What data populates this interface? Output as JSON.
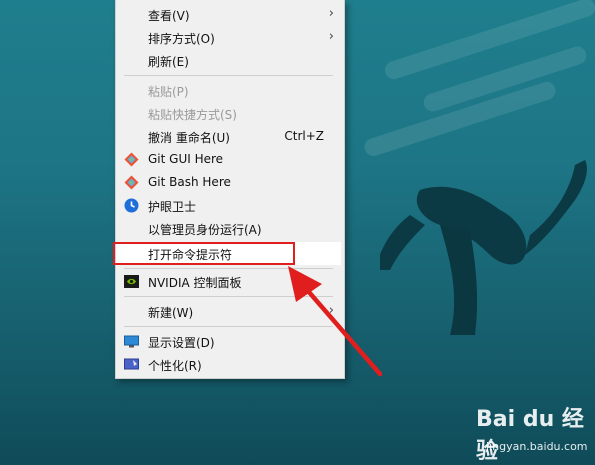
{
  "context_menu": {
    "items": [
      {
        "label": "查看(V)",
        "has_submenu": true
      },
      {
        "label": "排序方式(O)",
        "has_submenu": true
      },
      {
        "label": "刷新(E)"
      },
      {
        "label": "粘贴(P)",
        "disabled": true
      },
      {
        "label": "粘贴快捷方式(S)",
        "disabled": true
      },
      {
        "label": "撤消 重命名(U)",
        "shortcut": "Ctrl+Z"
      },
      {
        "label": "Git GUI Here",
        "icon": "git-icon"
      },
      {
        "label": "Git Bash Here",
        "icon": "git-icon"
      },
      {
        "label": "护眼卫士",
        "icon": "clock-icon"
      },
      {
        "label": "以管理员身份运行(A)"
      },
      {
        "label": "打开命令提示符",
        "highlighted": true
      },
      {
        "label": "NVIDIA 控制面板",
        "icon": "nvidia-icon"
      },
      {
        "label": "新建(W)",
        "has_submenu": true
      },
      {
        "label": "显示设置(D)",
        "icon": "display-icon"
      },
      {
        "label": "个性化(R)",
        "icon": "personalize-icon"
      }
    ]
  },
  "watermark": {
    "brand": "Bai du 经验",
    "url": "jingyan.baidu.com"
  },
  "colors": {
    "highlight_border": "#e01e1e",
    "arrow": "#e01e1e"
  }
}
